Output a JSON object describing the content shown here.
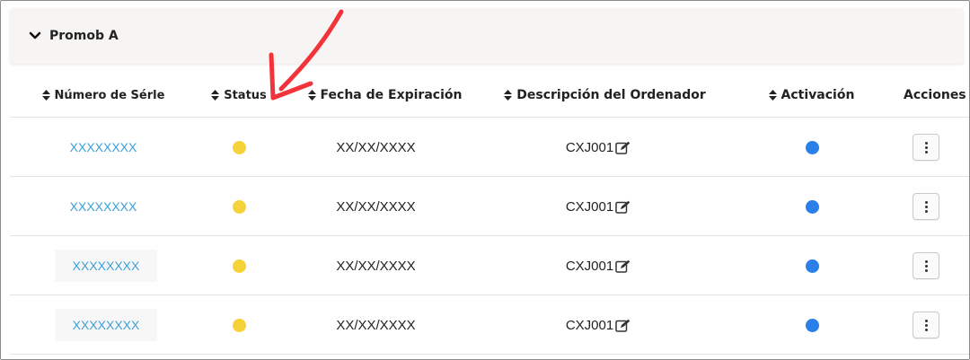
{
  "panel": {
    "title": "Promob A",
    "expand_icon": "chevron-down-icon"
  },
  "columns": [
    {
      "key": "serial",
      "label": "Número de Sérle",
      "sortable": true
    },
    {
      "key": "status",
      "label": "Status",
      "sortable": true
    },
    {
      "key": "expiration",
      "label": "Fecha de Expiración",
      "sortable": true
    },
    {
      "key": "description",
      "label": "Descripción del Ordenador",
      "sortable": true
    },
    {
      "key": "activation",
      "label": "Activación",
      "sortable": true
    },
    {
      "key": "actions",
      "label": "Acciones",
      "sortable": false
    }
  ],
  "rows": [
    {
      "serial": "XXXXXXXX",
      "status": "yellow",
      "expiration": "XX/XX/XXXX",
      "description": "CXJ001",
      "activation": "blue"
    },
    {
      "serial": "XXXXXXXX",
      "status": "yellow",
      "expiration": "XX/XX/XXXX",
      "description": "CXJ001",
      "activation": "blue"
    },
    {
      "serial": "XXXXXXXX",
      "status": "yellow",
      "expiration": "XX/XX/XXXX",
      "description": "CXJ001",
      "activation": "blue"
    },
    {
      "serial": "XXXXXXXX",
      "status": "yellow",
      "expiration": "XX/XX/XXXX",
      "description": "CXJ001",
      "activation": "blue"
    }
  ],
  "colors": {
    "link": "#3c9fd8",
    "status_yellow": "#f6d23a",
    "activation_blue": "#2a7fe8",
    "annotation_arrow": "#f2333a"
  },
  "icons": {
    "sort": "sort-icon",
    "edit": "edit-icon",
    "actions": "kebab-menu-icon"
  }
}
